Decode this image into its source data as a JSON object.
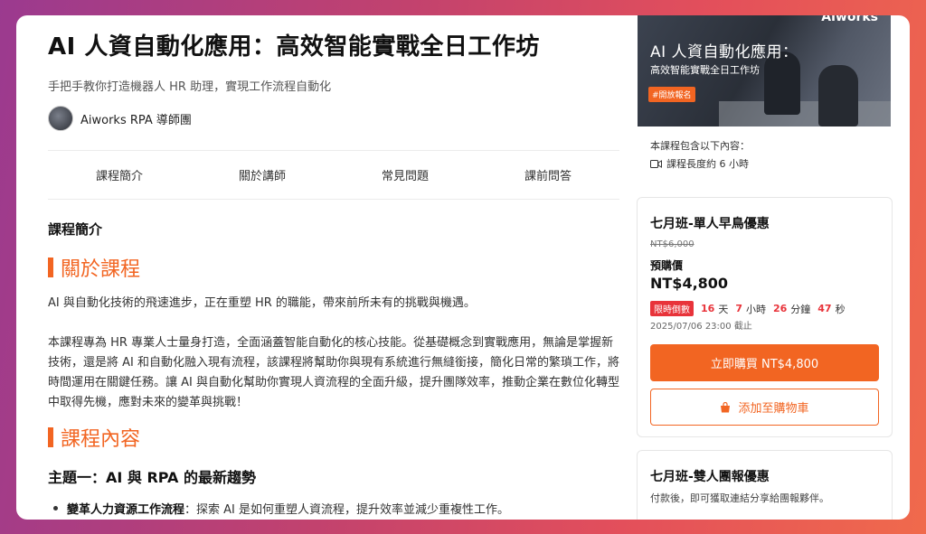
{
  "course": {
    "title": "AI 人資自動化應用：高效智能實戰全日工作坊",
    "subtitle": "手把手教你打造機器人 HR 助理，實現工作流程自動化",
    "author": "Aiworks RPA 導師團"
  },
  "tabs": [
    "課程簡介",
    "關於講師",
    "常見問題",
    "課前問答"
  ],
  "content": {
    "section_label": "課程簡介",
    "heading_about": "關於課程",
    "para1": "AI 與自動化技術的飛速進步，正在重塑 HR 的職能，帶來前所未有的挑戰與機遇。",
    "para2": "本課程專為 HR 專業人士量身打造，全面涵蓋智能自動化的核心技能。從基礎概念到實戰應用，無論是掌握新技術，還是將 AI 和自動化融入現有流程，該課程將幫助你與現有系統進行無縫銜接，簡化日常的繁瑣工作，將時間運用在關鍵任務。讓 AI 與自動化幫助你實現人資流程的全面升級，提升團隊效率，推動企業在數位化轉型中取得先機，應對未來的變革與挑戰！",
    "heading_content": "課程內容",
    "topic1": "主題一：AI 與 RPA 的最新趨勢",
    "bullet1_bold": "變革人力資源工作流程",
    "bullet1_text": "：探索 AI 是如何重塑人資流程，提升效率並減少重複性工作。"
  },
  "promo": {
    "brand": "Aiworks",
    "title": "AI 人資自動化應用：",
    "subtitle": "高效智能實戰全日工作坊",
    "tag": "#開放報名"
  },
  "includes": {
    "label": "本課程包含以下內容：",
    "duration": "課程長度約 6 小時",
    "icon": "video-icon"
  },
  "offer1": {
    "title": "七月班-單人早鳥優惠",
    "original_price": "NT$6,000",
    "presale_label": "預購價",
    "price": "NT$4,800",
    "countdown_label": "限時倒數",
    "days": "16",
    "days_unit": "天",
    "hours": "7",
    "hours_unit": "小時",
    "minutes": "26",
    "minutes_unit": "分鐘",
    "seconds": "47",
    "seconds_unit": "秒",
    "deadline": "2025/07/06 23:00 截止",
    "buy_label": "立即購買 NT$4,800",
    "cart_label": "添加至購物車",
    "cart_icon": "shopping-bag-icon"
  },
  "offer2": {
    "title": "七月班-雙人團報優惠",
    "desc": "付款後，即可獲取連結分享給團報夥伴。"
  },
  "colors": {
    "accent": "#f26522",
    "countdown": "#e8333a"
  }
}
